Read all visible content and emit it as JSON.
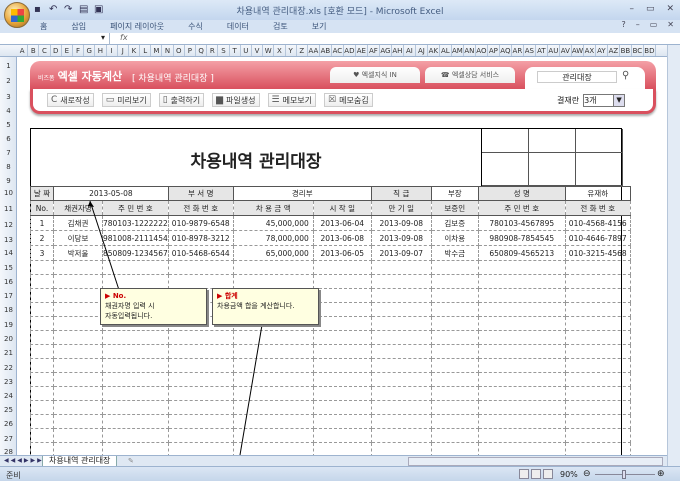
{
  "window": {
    "title": "차용내역 관리대장.xls  [호환 모드] - Microsoft Excel",
    "controls": [
      "–",
      "▭",
      "✕"
    ]
  },
  "ribbon_tabs": [
    "홈",
    "삽입",
    "페이지 레이아웃",
    "수식",
    "데이터",
    "검토",
    "보기"
  ],
  "formula": {
    "fx": "fx"
  },
  "columns": [
    "A",
    "B",
    "C",
    "D",
    "E",
    "F",
    "G",
    "H",
    "I",
    "J",
    "K",
    "L",
    "M",
    "N",
    "O",
    "P",
    "Q",
    "R",
    "S",
    "T",
    "U",
    "V",
    "W",
    "X",
    "Y",
    "Z",
    "AA",
    "AB",
    "AC",
    "AD",
    "AE",
    "AF",
    "AG",
    "AH",
    "AI",
    "AJ",
    "AK",
    "AL",
    "AM",
    "AN",
    "AO",
    "AP",
    "AQ",
    "AR",
    "AS",
    "AT",
    "AU",
    "AV",
    "AW",
    "AX",
    "AY",
    "AZ",
    "BB",
    "BC",
    "BD"
  ],
  "rows": [
    "1",
    "2",
    "3",
    "4",
    "5",
    "6",
    "7",
    "8",
    "9",
    "10",
    "11",
    "12",
    "13",
    "14",
    "15",
    "16",
    "17",
    "18",
    "19",
    "20",
    "21",
    "22",
    "23",
    "24",
    "25",
    "26",
    "27",
    "28"
  ],
  "banner": {
    "brand_small": "비즈폼",
    "brand": "엑셀 자동계산",
    "subtitle": "[ 차용내역 관리대장 ]",
    "tab1": "♥ 엑셀지식 IN",
    "tab2": "☎ 엑셀상담 서비스",
    "search": "관리대장",
    "tools": [
      "새로작성",
      "미리보기",
      "출력하기",
      "파일생성",
      "메모보기",
      "메모숨김"
    ],
    "pay_label": "결재란",
    "pay_value": "3개"
  },
  "doc": {
    "title": "차용내역 관리대장",
    "info": {
      "date_label": "날 짜",
      "date": "2013-05-08",
      "dept_label": "부 서 명",
      "dept": "경리부",
      "rank_label": "직 급",
      "rank": "부장",
      "name_label": "성 명",
      "name": "유재하"
    },
    "headers": [
      "No.",
      "채권자명",
      "주 민 번 호",
      "전 화 번 호",
      "차 용 금 액",
      "시 작 일",
      "만 기 일",
      "보증인",
      "주 민 번 호",
      "전 화 번 호"
    ],
    "records": [
      [
        "1",
        "김채권",
        "780103-1222222",
        "010-9879-6548",
        "45,000,000",
        "2013-06-04",
        "2013-09-08",
        "김보증",
        "780103-4567895",
        "010-4568-4156"
      ],
      [
        "2",
        "이당보",
        "981008-2111454",
        "010-8978-3212",
        "78,000,000",
        "2013-06-08",
        "2013-09-08",
        "이차용",
        "980908-7854545",
        "010-4646-7897"
      ],
      [
        "3",
        "박저울",
        "850809-1234567",
        "010-5468-6544",
        "65,000,000",
        "2013-06-05",
        "2013-09-07",
        "박수금",
        "650809-4565213",
        "010-3215-4568"
      ]
    ]
  },
  "comments": [
    {
      "title": "No.",
      "text": "채권자명 입력 시\n자동입력됩니다."
    },
    {
      "title": "합계",
      "text": "차용금액 합을 계산합니다."
    }
  ],
  "sheet_tab": "차용내역 관리대장",
  "status": {
    "ready": "준비",
    "zoom": "90%"
  }
}
